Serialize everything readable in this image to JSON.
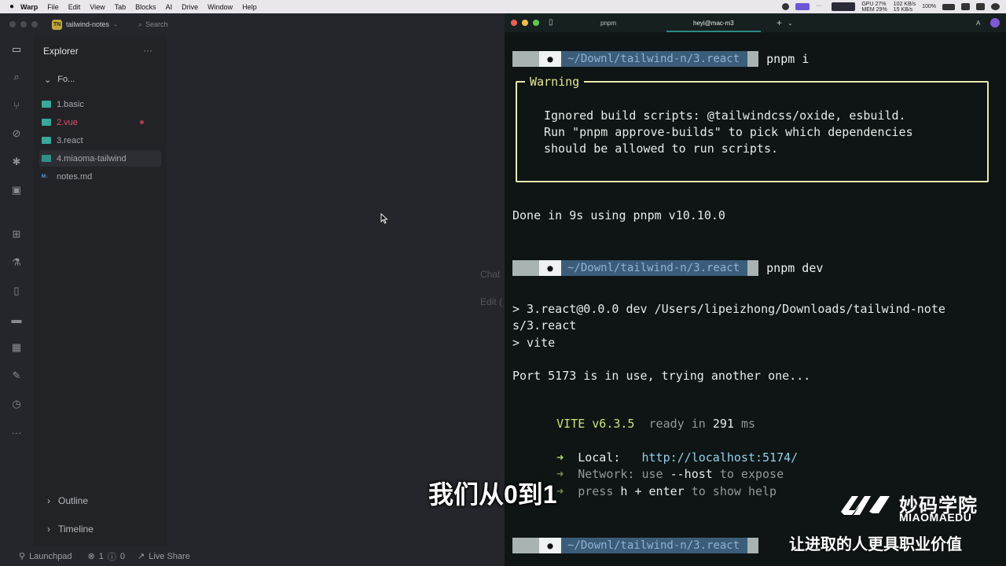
{
  "menubar": {
    "app": "Warp",
    "items": [
      "File",
      "Edit",
      "View",
      "Tab",
      "Blocks",
      "AI",
      "Drive",
      "Window",
      "Help"
    ],
    "status": {
      "cpu_label": "GPU",
      "mem_label": "MEM",
      "cpu_value": "27%",
      "mem_value": "29%",
      "net_up": "102 KB/s",
      "net_down": "15 KB/s",
      "battery": "100%"
    }
  },
  "editor": {
    "project_badge": "TN",
    "project_name": "tailwind-notes",
    "search_placeholder": "Search",
    "explorer_title": "Explorer",
    "more": "···",
    "folder_label": "Fo...",
    "files": [
      {
        "name": "1.basic",
        "type": "folder"
      },
      {
        "name": "2.vue",
        "type": "folder",
        "modified": true
      },
      {
        "name": "3.react",
        "type": "folder"
      },
      {
        "name": "4.miaoma-tailwind",
        "type": "folder",
        "active": true
      },
      {
        "name": "notes.md",
        "type": "markdown"
      }
    ],
    "md_icon_text": "M↓",
    "outline_label": "Outline",
    "timeline_label": "Timeline",
    "ghost_chat": "Chat",
    "ghost_edit": "Edit (",
    "status": {
      "launchpad": "Launchpad",
      "errors": "1",
      "warnings": "0",
      "live_share": "Live Share"
    }
  },
  "terminal": {
    "tab1": "pnpm",
    "tab2": "heyi@mac-m3",
    "plus": "+",
    "prompt_path": "~/Downl/tailwind-n/3.react",
    "cmd1": "pnpm i",
    "warning_title": "Warning",
    "warning_lines": [
      "Ignored build scripts: @tailwindcss/oxide, esbuild.",
      "Run \"pnpm approve-builds\" to pick which dependencies",
      "should be allowed to run scripts."
    ],
    "done_line": "Done in 9s using pnpm v10.10.0",
    "cmd2": "pnpm dev",
    "dev_line1": "> 3.react@0.0.0 dev /Users/lipeizhong/Downloads/tailwind-note",
    "dev_line2": "s/3.react",
    "dev_line3": "> vite",
    "port_line": "Port 5173 is in use, trying another one...",
    "vite_name": "VITE v6.3.5",
    "vite_ready": "ready in",
    "vite_ms": "291",
    "vite_ms_unit": "ms",
    "local_label": "Local:",
    "local_url": "http://localhost:5174/",
    "network_label": "Network:",
    "network_text_a": "use",
    "network_text_b": "--host",
    "network_text_c": "to expose",
    "help_text_a": "press",
    "help_text_b": "h + enter",
    "help_text_c": "to show help",
    "arrow": "➜"
  },
  "overlay": {
    "subtitle": "我们从0到1",
    "brand_cn": "妙码学院",
    "brand_en": "MIAOMAEDU",
    "slogan": "让进取的人更具职业价值"
  }
}
